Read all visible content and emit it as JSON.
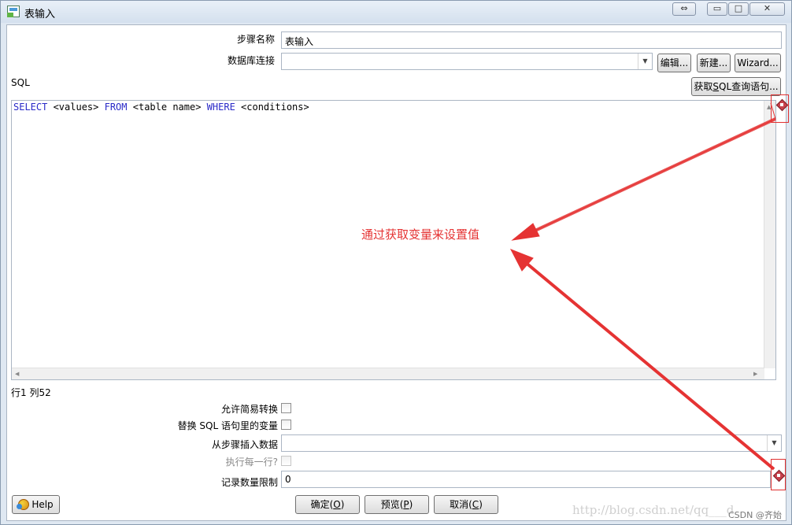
{
  "window": {
    "title": "表输入",
    "buttons": {
      "restore": "⇔",
      "minimize": "▭",
      "maximize": "□",
      "close": "✕"
    }
  },
  "form": {
    "step_name_label": "步骤名称",
    "step_name_value": "表输入",
    "db_connection_label": "数据库连接",
    "db_connection_value": "",
    "edit_label": "编辑...",
    "new_label": "新建...",
    "wizard_label": "Wizard...",
    "sql_label": "SQL",
    "get_sql_label": "获取SQL查询语句..."
  },
  "editor": {
    "keywords": [
      "SELECT",
      "FROM",
      "WHERE"
    ],
    "tokens": [
      " <values> ",
      " <table name> ",
      " <conditions>"
    ],
    "status": "行1 列52"
  },
  "options": {
    "allow_lazy_conversion": "允许简易转换",
    "replace_variables": "替换 SQL 语句里的变量",
    "insert_data_from_step": "从步骤插入数据",
    "insert_data_value": "",
    "execute_each_row": "执行每一行?",
    "limit_label": "记录数量限制",
    "limit_value": "0"
  },
  "footer": {
    "help_label": "Help",
    "ok": {
      "text": "确定(",
      "key": "O",
      "end": ")"
    },
    "preview": {
      "text": "预览(",
      "key": "P",
      "end": ")"
    },
    "cancel": {
      "text": "取消(",
      "key": "C",
      "end": ")"
    }
  },
  "annotation": {
    "text": "通过获取变量来设置值",
    "color": "#e53333"
  },
  "watermark": {
    "url": "http://blog.csdn.net/qq___d",
    "csdn": "CSDN @齐始"
  },
  "icons": [
    "app-icon",
    "variable-icon",
    "help-icon",
    "dropdown-arrow-icon",
    "scroll-arrow-icon"
  ]
}
